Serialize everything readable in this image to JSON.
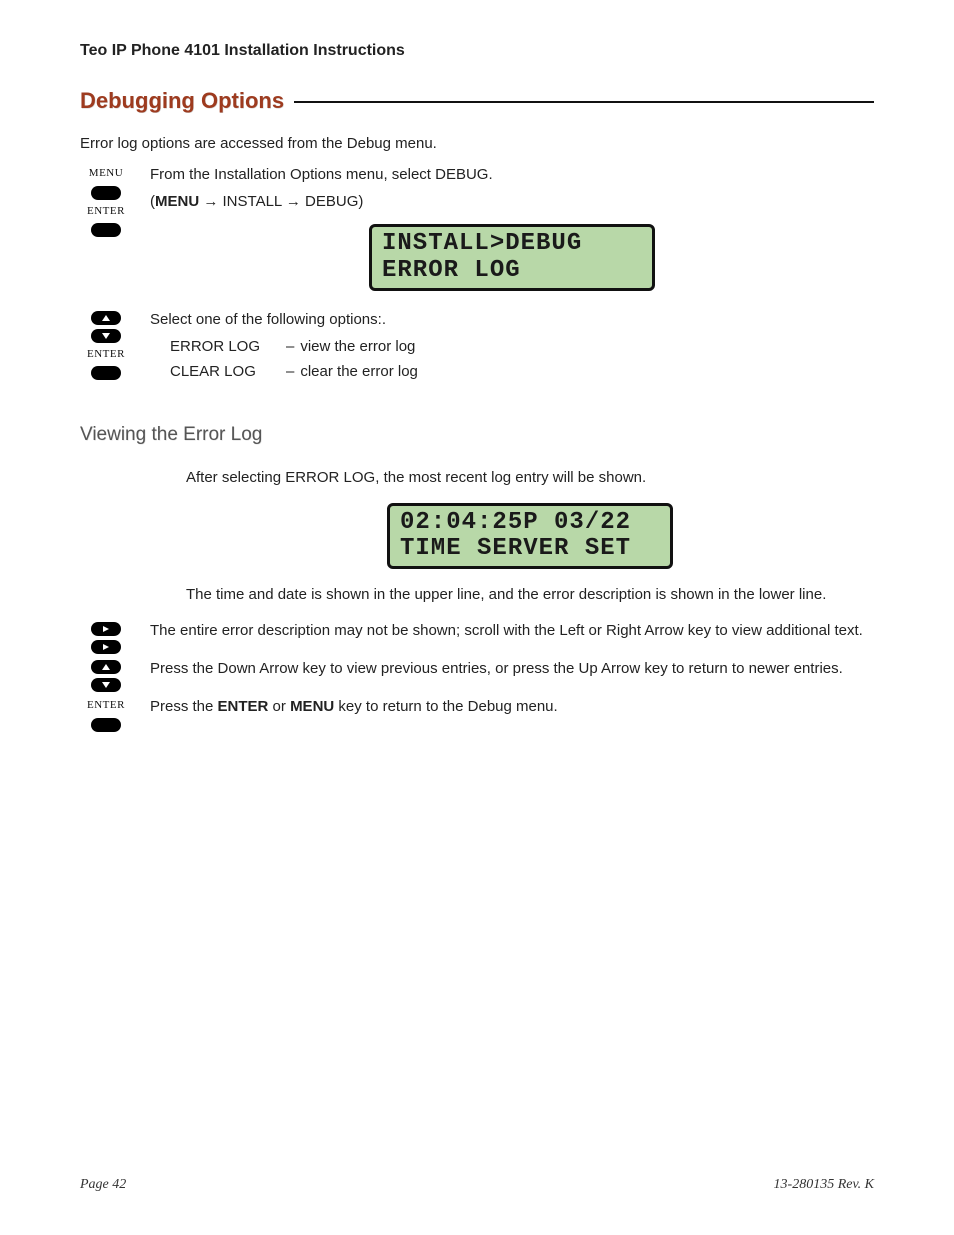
{
  "header": {
    "title": "Teo IP Phone 4101 Installation Instructions"
  },
  "section": {
    "title": "Debugging Options"
  },
  "intro": {
    "text": "Error log options are accessed from the Debug menu."
  },
  "icons": {
    "menu_label": "MENU",
    "enter_label": "ENTER"
  },
  "step1": {
    "line1": "From the Installation Options menu, select DEBUG.",
    "path_prefix": "(",
    "path_menu": "MENU",
    "path_arrow1": " → ",
    "path_install": "INSTALL",
    "path_arrow2": " → ",
    "path_debug": "DEBUG)",
    "lcd_line1": "INSTALL>DEBUG",
    "lcd_line2": "ERROR LOG"
  },
  "step2": {
    "intro": "Select one of the following options:.",
    "options": [
      {
        "name": "ERROR LOG",
        "dash": "–",
        "desc": "view the error log"
      },
      {
        "name": "CLEAR LOG",
        "dash": "–",
        "desc": "clear the error log"
      }
    ]
  },
  "sub": {
    "heading": "Viewing the Error Log"
  },
  "view": {
    "p1": "After selecting ERROR LOG, the most recent log entry will be shown.",
    "lcd_line1": "02:04:25P 03/22",
    "lcd_line2": "TIME SERVER SET",
    "p2": "The time and date is shown in the upper line, and the error description is shown in the lower line.",
    "p3": "The entire error description may not be shown; scroll with the Left or Right Arrow key to view additional text.",
    "p4": "Press the Down Arrow key to view previous entries, or press the Up Arrow key to return to newer entries.",
    "p5_a": "Press the ",
    "p5_enter": "ENTER",
    "p5_b": " or ",
    "p5_menu": "MENU",
    "p5_c": " key to return to the Debug menu."
  },
  "footer": {
    "page": "Page 42",
    "rev": "13-280135  Rev. K"
  }
}
